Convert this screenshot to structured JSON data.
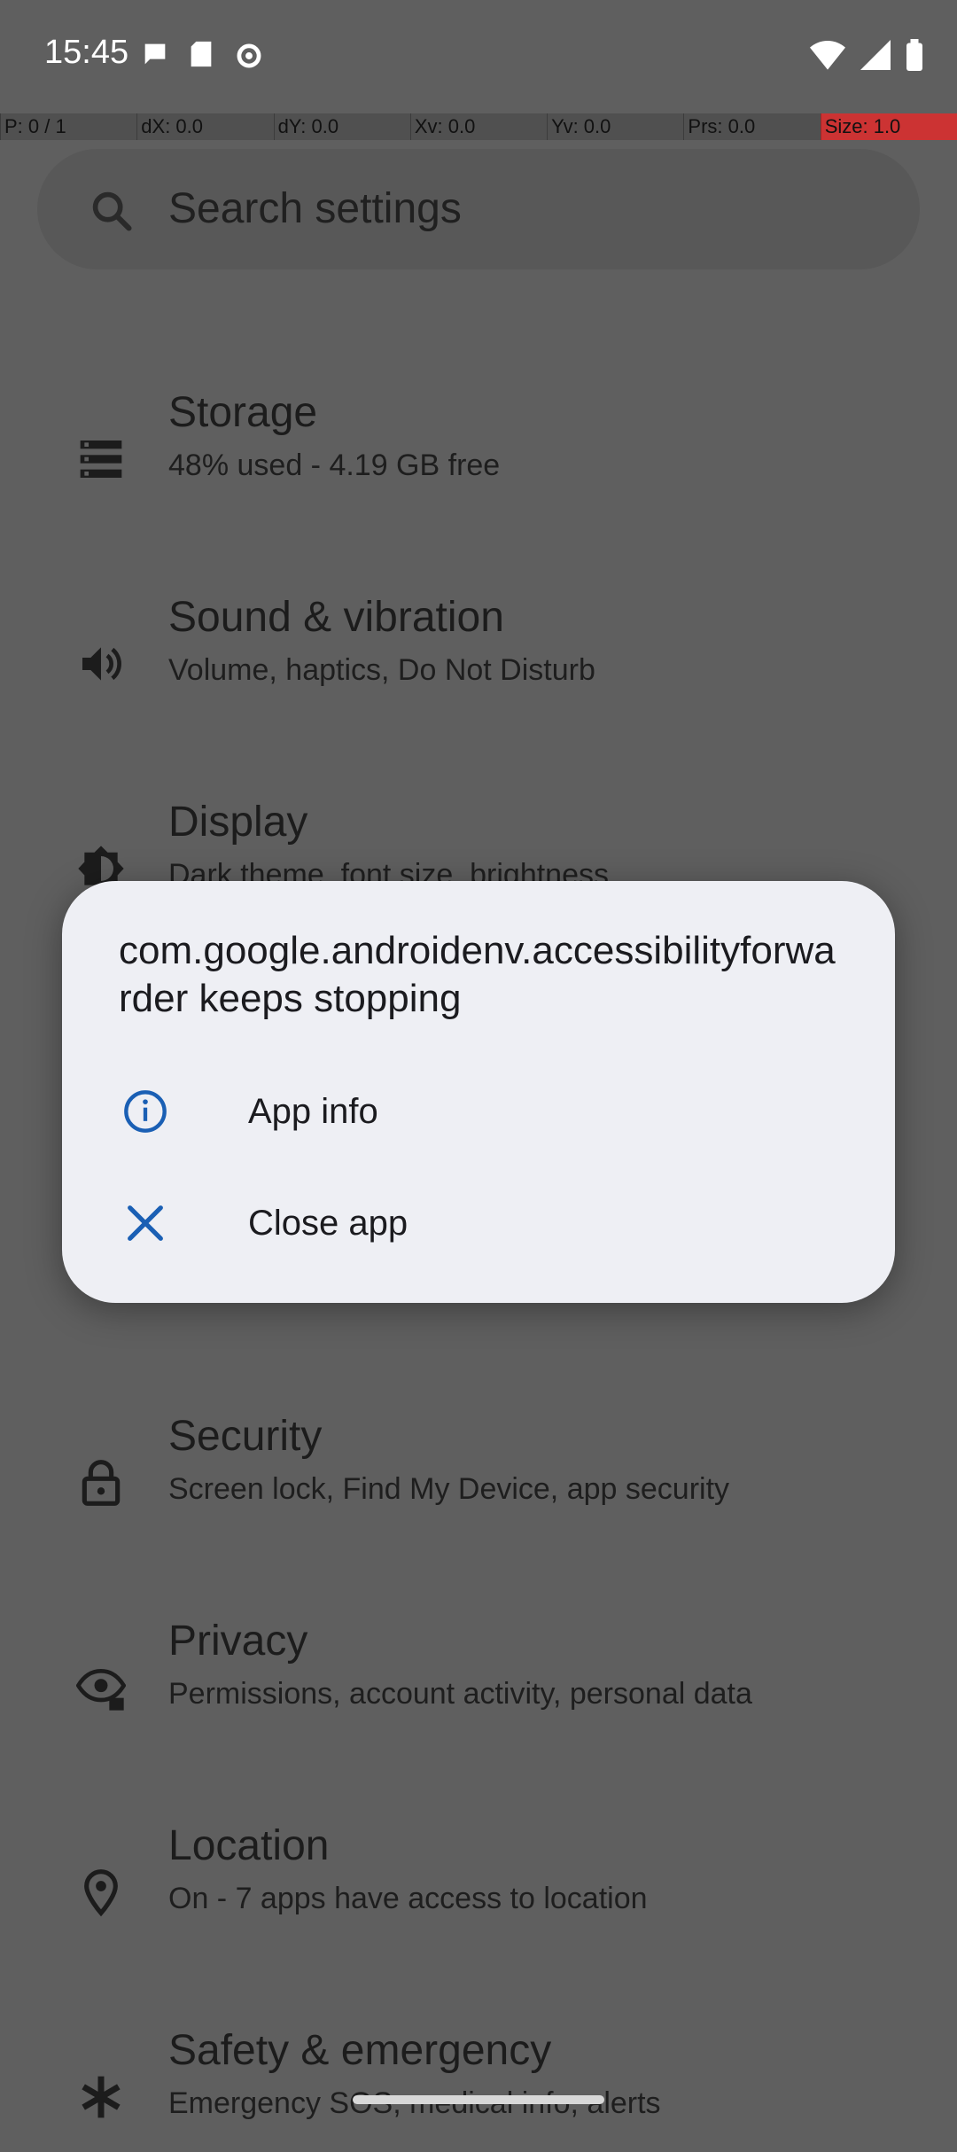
{
  "status_bar": {
    "time": "15:45",
    "left_icons": [
      "chat-bubble-icon",
      "sd-card-icon",
      "gear-icon"
    ],
    "right_icons": [
      "wifi-icon",
      "cellular-signal-icon",
      "battery-icon"
    ]
  },
  "debug_overlay": [
    "P: 0 / 1",
    "dX: 0.0",
    "dY: 0.0",
    "Xv: 0.0",
    "Yv: 0.0",
    "Prs: 0.0",
    "Size: 1.0"
  ],
  "search": {
    "placeholder": "Search settings",
    "icon": "search-icon"
  },
  "settings_items": [
    {
      "title": "Storage",
      "subtitle": "48% used - 4.19 GB free",
      "icon": "storage-icon"
    },
    {
      "title": "Sound & vibration",
      "subtitle": "Volume, haptics, Do Not Disturb",
      "icon": "volume-icon"
    },
    {
      "title": "Display",
      "subtitle": "Dark theme, font size, brightness",
      "icon": "brightness-icon"
    },
    {
      "title": "Security",
      "subtitle": "Screen lock, Find My Device, app security",
      "icon": "lock-icon"
    },
    {
      "title": "Privacy",
      "subtitle": "Permissions, account activity, personal data",
      "icon": "eye-lock-icon"
    },
    {
      "title": "Location",
      "subtitle": "On - 7 apps have access to location",
      "icon": "location-pin-icon"
    },
    {
      "title": "Safety & emergency",
      "subtitle": "Emergency SOS, medical info, alerts",
      "icon": "asterisk-icon"
    }
  ],
  "dialog": {
    "title": "com.google.androidenv.accessibilityforwarder keeps stopping",
    "options": [
      {
        "label": "App info",
        "icon": "info-icon"
      },
      {
        "label": "Close app",
        "icon": "close-icon"
      }
    ],
    "accent": "#1a5fb4"
  }
}
